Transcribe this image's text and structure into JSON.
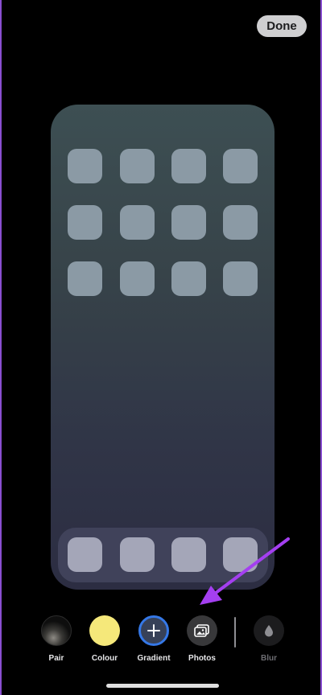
{
  "header": {
    "done_label": "Done"
  },
  "toolbar": {
    "items": [
      {
        "label": "Pair",
        "icon": "pair-thumbnail-icon"
      },
      {
        "label": "Colour",
        "icon": "colour-swatch-icon",
        "color": "#f5e87a"
      },
      {
        "label": "Gradient",
        "icon": "plus-icon",
        "selected": true
      },
      {
        "label": "Photos",
        "icon": "photos-icon"
      },
      {
        "label": "Blur",
        "icon": "drop-icon",
        "disabled": true
      }
    ]
  },
  "colors": {
    "accent": "#3578e7",
    "annotation_arrow": "#a43ff0"
  }
}
